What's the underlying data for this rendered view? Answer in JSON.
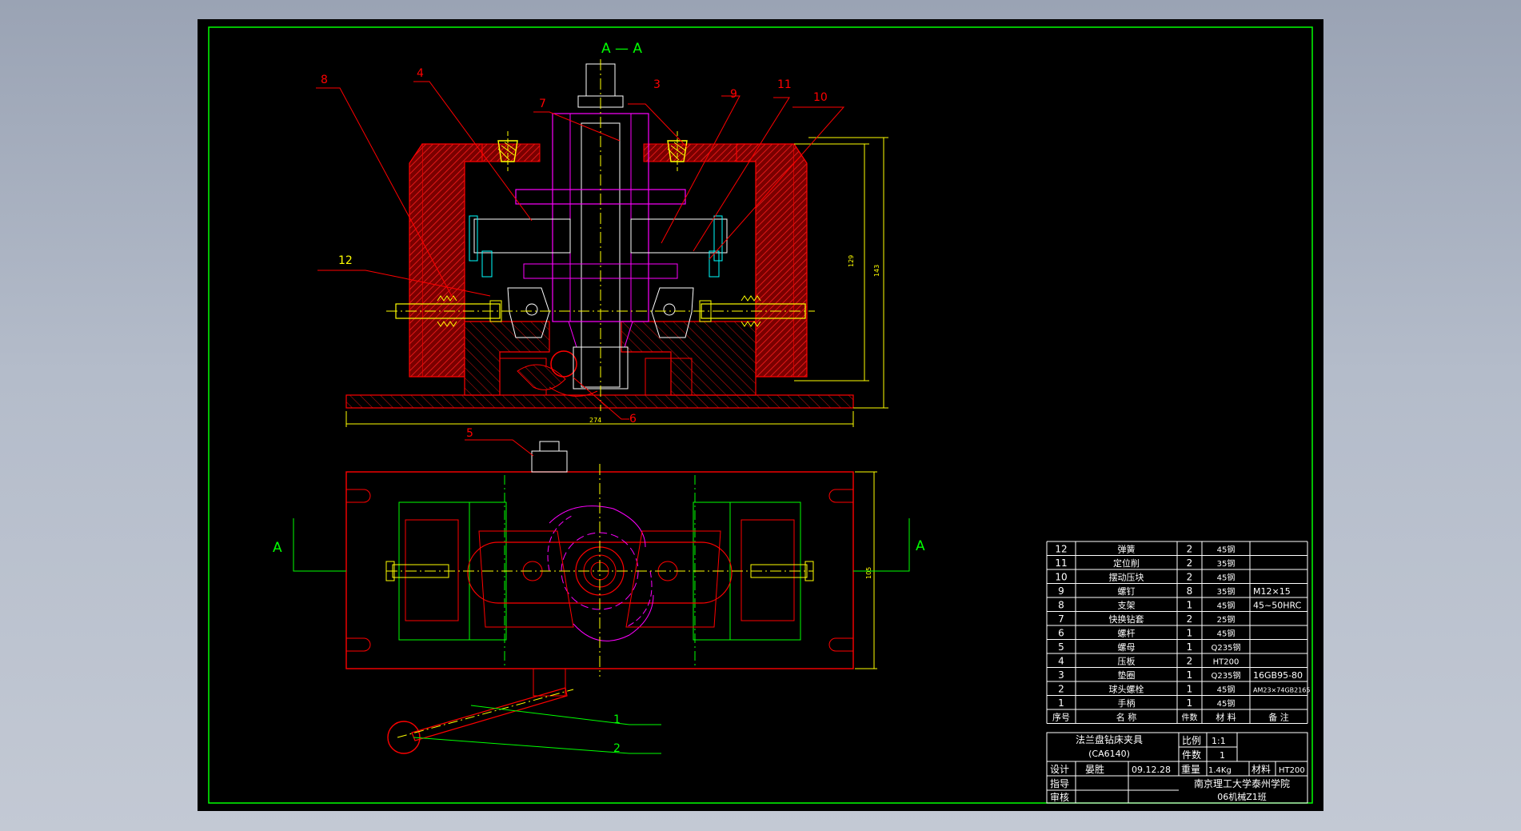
{
  "drawing": {
    "section_title": "A — A",
    "section_marker_left": "A",
    "section_marker_right": "A",
    "dim_width": "274",
    "dim_height_inner": "129",
    "dim_height_outer": "143",
    "dim_plan_height": "105",
    "balloons": {
      "b1": "1",
      "b2": "2",
      "b3": "3",
      "b4": "4",
      "b5": "5",
      "b6": "6",
      "b7": "7",
      "b8": "8",
      "b9": "9",
      "b10": "10",
      "b11": "11",
      "b12": "12"
    },
    "colors": {
      "background": "#000000",
      "frame": "#00ff00",
      "part_outline": "#ff0000",
      "hatch": "#cc1111",
      "centerline": "#ffff00",
      "spindle": "#ff00ff",
      "detail": "#00ffff",
      "text": "#ffffff"
    }
  },
  "bom": {
    "rows": [
      {
        "no": "12",
        "name": "弹簧",
        "qty": "2",
        "material": "45钢",
        "remark": ""
      },
      {
        "no": "11",
        "name": "定位削",
        "qty": "2",
        "material": "35钢",
        "remark": ""
      },
      {
        "no": "10",
        "name": "摆动压块",
        "qty": "2",
        "material": "45钢",
        "remark": ""
      },
      {
        "no": "9",
        "name": "螺钉",
        "qty": "8",
        "material": "35钢",
        "remark": "M12×15"
      },
      {
        "no": "8",
        "name": "支架",
        "qty": "1",
        "material": "45钢",
        "remark": "45~50HRC"
      },
      {
        "no": "7",
        "name": "快换钻套",
        "qty": "2",
        "material": "25钢",
        "remark": ""
      },
      {
        "no": "6",
        "name": "螺杆",
        "qty": "1",
        "material": "45钢",
        "remark": ""
      },
      {
        "no": "5",
        "name": "螺母",
        "qty": "1",
        "material": "Q235钢",
        "remark": ""
      },
      {
        "no": "4",
        "name": "压板",
        "qty": "2",
        "material": "HT200",
        "remark": ""
      },
      {
        "no": "3",
        "name": "垫圈",
        "qty": "1",
        "material": "Q235钢",
        "remark": "16GB95-80"
      },
      {
        "no": "2",
        "name": "球头螺栓",
        "qty": "1",
        "material": "45钢",
        "remark": "AM23×74GB2165"
      },
      {
        "no": "1",
        "name": "手柄",
        "qty": "1",
        "material": "45钢",
        "remark": ""
      }
    ],
    "header": {
      "no": "序号",
      "name": "名 称",
      "qty": "件数",
      "material": "材 料",
      "remark": "备 注"
    }
  },
  "title_block": {
    "product_name": "法兰盘钻床夹具",
    "product_sub": "(CA6140)",
    "scale_label": "比例",
    "scale_value": "1:1",
    "count_label": "件数",
    "count_value": "1",
    "design_label": "设计",
    "designer": "晏胜",
    "date": "09.12.28",
    "weight_label": "重量",
    "weight_value": "1.4Kg",
    "material_label": "材料",
    "material_value": "HT200",
    "guide_label": "指导",
    "review_label": "审核",
    "school": "南京理工大学泰州学院",
    "class": "06机械Z1班"
  }
}
